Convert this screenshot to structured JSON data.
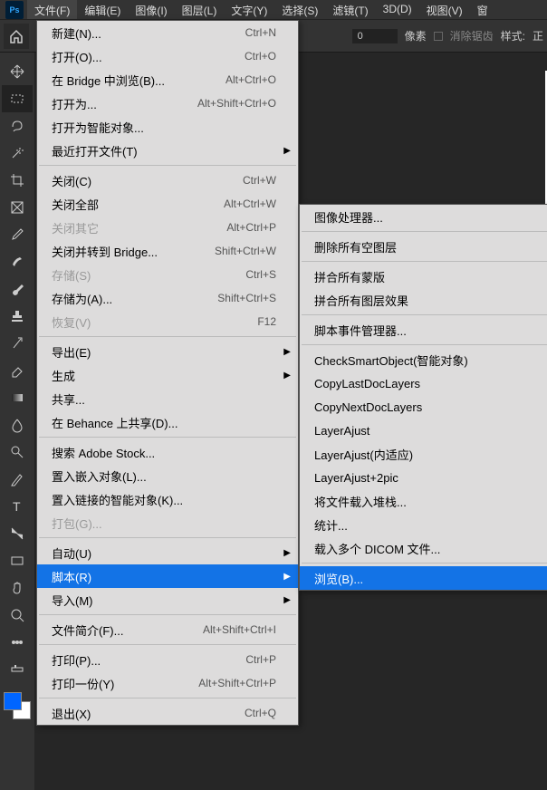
{
  "menubar": {
    "items": [
      {
        "label": "文件(F)"
      },
      {
        "label": "编辑(E)"
      },
      {
        "label": "图像(I)"
      },
      {
        "label": "图层(L)"
      },
      {
        "label": "文字(Y)"
      },
      {
        "label": "选择(S)"
      },
      {
        "label": "滤镜(T)"
      },
      {
        "label": "3D(D)"
      },
      {
        "label": "视图(V)"
      },
      {
        "label": "窗"
      }
    ]
  },
  "optionsbar": {
    "value1": "0",
    "unit": "像素",
    "antialias": "消除锯齿",
    "style_label": "样式:",
    "style_value": "正"
  },
  "file_menu": [
    {
      "t": "item",
      "label": "新建(N)...",
      "shortcut": "Ctrl+N"
    },
    {
      "t": "item",
      "label": "打开(O)...",
      "shortcut": "Ctrl+O"
    },
    {
      "t": "item",
      "label": "在 Bridge 中浏览(B)...",
      "shortcut": "Alt+Ctrl+O"
    },
    {
      "t": "item",
      "label": "打开为...",
      "shortcut": "Alt+Shift+Ctrl+O"
    },
    {
      "t": "item",
      "label": "打开为智能对象..."
    },
    {
      "t": "item",
      "label": "最近打开文件(T)",
      "sub": true
    },
    {
      "t": "sep"
    },
    {
      "t": "item",
      "label": "关闭(C)",
      "shortcut": "Ctrl+W"
    },
    {
      "t": "item",
      "label": "关闭全部",
      "shortcut": "Alt+Ctrl+W"
    },
    {
      "t": "item",
      "label": "关闭其它",
      "shortcut": "Alt+Ctrl+P",
      "disabled": true
    },
    {
      "t": "item",
      "label": "关闭并转到 Bridge...",
      "shortcut": "Shift+Ctrl+W"
    },
    {
      "t": "item",
      "label": "存储(S)",
      "shortcut": "Ctrl+S",
      "disabled": true
    },
    {
      "t": "item",
      "label": "存储为(A)...",
      "shortcut": "Shift+Ctrl+S"
    },
    {
      "t": "item",
      "label": "恢复(V)",
      "shortcut": "F12",
      "disabled": true
    },
    {
      "t": "sep"
    },
    {
      "t": "item",
      "label": "导出(E)",
      "sub": true
    },
    {
      "t": "item",
      "label": "生成",
      "sub": true
    },
    {
      "t": "item",
      "label": "共享..."
    },
    {
      "t": "item",
      "label": "在 Behance 上共享(D)..."
    },
    {
      "t": "sep"
    },
    {
      "t": "item",
      "label": "搜索 Adobe Stock..."
    },
    {
      "t": "item",
      "label": "置入嵌入对象(L)..."
    },
    {
      "t": "item",
      "label": "置入链接的智能对象(K)..."
    },
    {
      "t": "item",
      "label": "打包(G)...",
      "disabled": true
    },
    {
      "t": "sep"
    },
    {
      "t": "item",
      "label": "自动(U)",
      "sub": true
    },
    {
      "t": "item",
      "label": "脚本(R)",
      "sub": true,
      "highlight": true
    },
    {
      "t": "item",
      "label": "导入(M)",
      "sub": true
    },
    {
      "t": "sep"
    },
    {
      "t": "item",
      "label": "文件简介(F)...",
      "shortcut": "Alt+Shift+Ctrl+I"
    },
    {
      "t": "sep"
    },
    {
      "t": "item",
      "label": "打印(P)...",
      "shortcut": "Ctrl+P"
    },
    {
      "t": "item",
      "label": "打印一份(Y)",
      "shortcut": "Alt+Shift+Ctrl+P"
    },
    {
      "t": "sep"
    },
    {
      "t": "item",
      "label": "退出(X)",
      "shortcut": "Ctrl+Q"
    }
  ],
  "script_submenu": [
    {
      "t": "item",
      "label": "图像处理器..."
    },
    {
      "t": "sep"
    },
    {
      "t": "item",
      "label": "删除所有空图层"
    },
    {
      "t": "sep"
    },
    {
      "t": "item",
      "label": "拼合所有蒙版"
    },
    {
      "t": "item",
      "label": "拼合所有图层效果"
    },
    {
      "t": "sep"
    },
    {
      "t": "item",
      "label": "脚本事件管理器..."
    },
    {
      "t": "sep"
    },
    {
      "t": "item",
      "label": "CheckSmartObject(智能对象)"
    },
    {
      "t": "item",
      "label": "CopyLastDocLayers"
    },
    {
      "t": "item",
      "label": "CopyNextDocLayers"
    },
    {
      "t": "item",
      "label": "LayerAjust"
    },
    {
      "t": "item",
      "label": "LayerAjust(内适应)"
    },
    {
      "t": "item",
      "label": "LayerAjust+2pic"
    },
    {
      "t": "item",
      "label": "将文件载入堆栈..."
    },
    {
      "t": "item",
      "label": "统计..."
    },
    {
      "t": "item",
      "label": "载入多个 DICOM 文件..."
    },
    {
      "t": "sep"
    },
    {
      "t": "item",
      "label": "浏览(B)...",
      "highlight": true
    }
  ],
  "tools": [
    "move",
    "marquee",
    "lasso",
    "wand",
    "crop",
    "frame",
    "eyedropper",
    "healing",
    "brush",
    "stamp",
    "history",
    "eraser",
    "gradient",
    "blur",
    "dodge",
    "pen",
    "type",
    "path",
    "rect",
    "hand",
    "zoom",
    "extra1",
    "extra2"
  ]
}
